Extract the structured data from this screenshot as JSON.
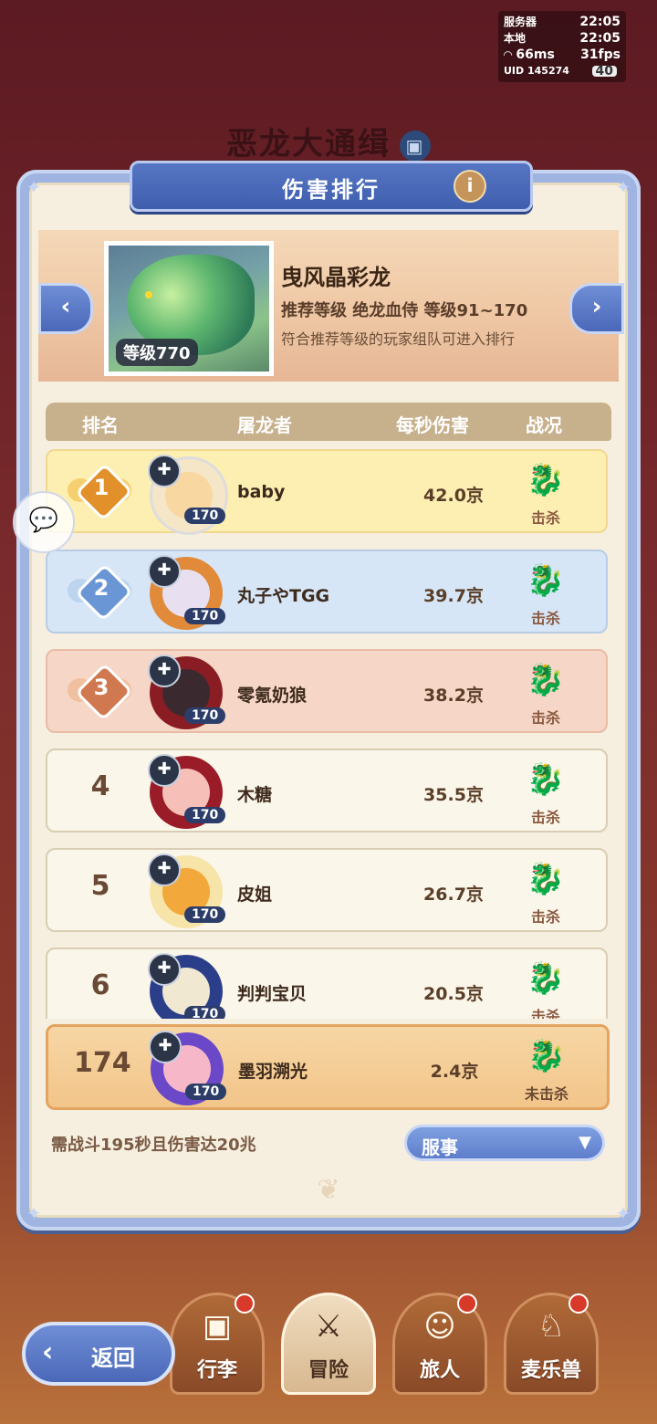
{
  "status": {
    "server_label": "服务器",
    "server_time": "22:05",
    "local_label": "本地",
    "local_time": "22:05",
    "ping": "66ms",
    "fps": "31fps",
    "uid": "UID 145274",
    "battery": "40"
  },
  "background_title": "恶龙大通缉",
  "panel": {
    "title": "伤害排行",
    "info_icon": "i"
  },
  "boss": {
    "name": "曳风晶彩龙",
    "level_tag": "等级770",
    "recommend": "推荐等级 绝龙血侍 等级91~170",
    "note": "符合推荐等级的玩家组队可进入排行"
  },
  "table_headers": {
    "rank": "排名",
    "slayer": "屠龙者",
    "dps": "每秒伤害",
    "status": "战况"
  },
  "rows": [
    {
      "rank": "1",
      "name": "baby",
      "level": "170",
      "dps": "42.0京",
      "result": "击杀"
    },
    {
      "rank": "2",
      "name": "丸子やTGG",
      "level": "170",
      "dps": "39.7京",
      "result": "击杀"
    },
    {
      "rank": "3",
      "name": "零氪奶狼",
      "level": "170",
      "dps": "38.2京",
      "result": "击杀"
    },
    {
      "rank": "4",
      "name": "木糖",
      "level": "170",
      "dps": "35.5京",
      "result": "击杀"
    },
    {
      "rank": "5",
      "name": "皮姐",
      "level": "170",
      "dps": "26.7京",
      "result": "击杀"
    },
    {
      "rank": "6",
      "name": "判判宝贝",
      "level": "170",
      "dps": "20.5京",
      "result": "击杀"
    }
  ],
  "self_row": {
    "rank": "174",
    "name": "墨羽溯光",
    "level": "170",
    "dps": "2.4京",
    "result": "未击杀"
  },
  "footer": {
    "requirement": "需战斗195秒且伤害达20兆",
    "server_select": "服事"
  },
  "bottom_nav": {
    "back": "返回",
    "items": [
      "行李",
      "冒险",
      "旅人",
      "麦乐兽"
    ]
  },
  "colors": {
    "gold_row": "#fdeeb2",
    "silver_row": "#d6e6f6",
    "bronze_row": "#f6d6c6",
    "normal_row": "#fbf6ea",
    "panel_blue": "#9fb4e0"
  }
}
